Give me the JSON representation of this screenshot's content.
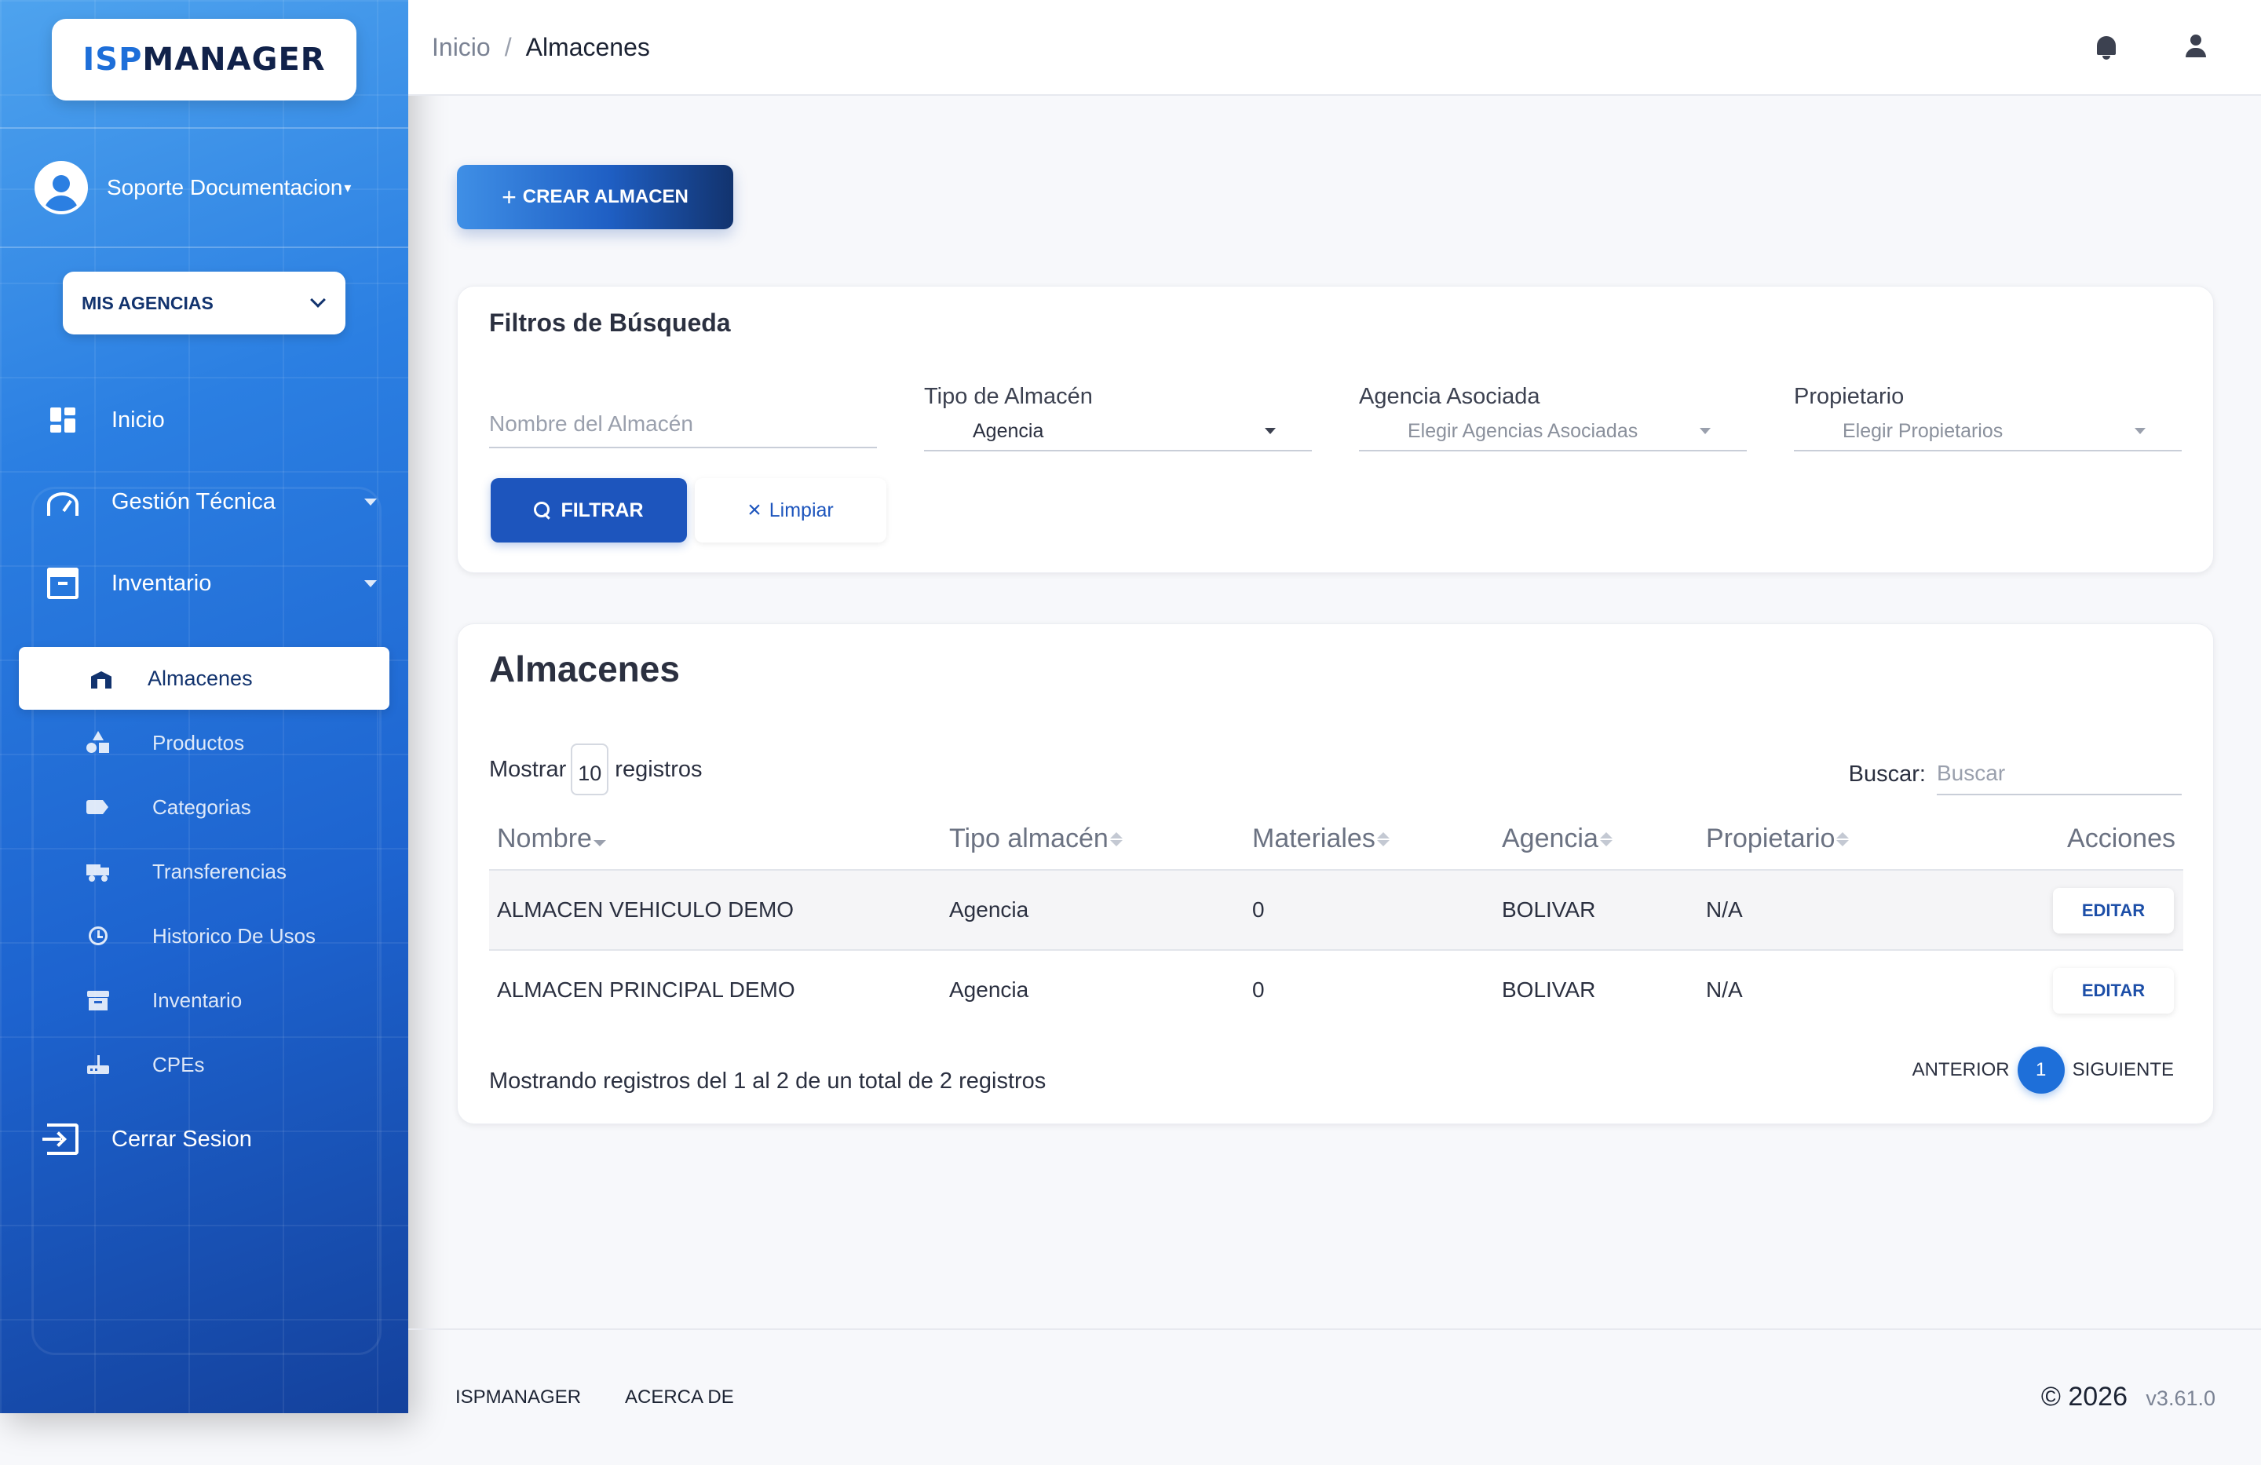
{
  "brand": {
    "logo_part1": "ISP",
    "logo_part2": "MANAGER"
  },
  "user": {
    "name": "Soporte Documentacion"
  },
  "agency_selector": {
    "label": "MIS AGENCIAS"
  },
  "sidebar": {
    "items": [
      {
        "label": "Inicio"
      },
      {
        "label": "Gestión Técnica"
      },
      {
        "label": "Inventario"
      }
    ],
    "sub_items": [
      {
        "label": "Almacenes",
        "active": true
      },
      {
        "label": "Productos"
      },
      {
        "label": "Categorias"
      },
      {
        "label": "Transferencias"
      },
      {
        "label": "Historico De Usos"
      },
      {
        "label": "Inventario"
      },
      {
        "label": "CPEs"
      }
    ],
    "logout": "Cerrar Sesion"
  },
  "breadcrumb": {
    "home": "Inicio",
    "separator": "/",
    "current": "Almacenes"
  },
  "create_button": {
    "icon": "+",
    "label": "CREAR ALMACEN"
  },
  "filters": {
    "title": "Filtros de Búsqueda",
    "name_placeholder": "Nombre del Almacén",
    "type": {
      "label": "Tipo de Almacén",
      "value": "Agencia"
    },
    "agency": {
      "label": "Agencia Asociada",
      "placeholder": "Elegir Agencias Asociadas"
    },
    "owner": {
      "label": "Propietario",
      "placeholder": "Elegir Propietarios"
    },
    "filter_button": "FILTRAR",
    "clear_button": "Limpiar"
  },
  "table": {
    "title": "Almacenes",
    "show_label": "Mostrar",
    "page_length": "10",
    "records_label": "registros",
    "search_label": "Buscar:",
    "search_placeholder": "Buscar",
    "columns": [
      "Nombre",
      "Tipo almacén",
      "Materiales",
      "Agencia",
      "Propietario",
      "Acciones"
    ],
    "rows": [
      {
        "name": "ALMACEN VEHICULO DEMO",
        "type": "Agencia",
        "materials": "0",
        "agency": "BOLIVAR",
        "owner": "N/A",
        "action": "EDITAR"
      },
      {
        "name": "ALMACEN PRINCIPAL DEMO",
        "type": "Agencia",
        "materials": "0",
        "agency": "BOLIVAR",
        "owner": "N/A",
        "action": "EDITAR"
      }
    ],
    "info": "Mostrando registros del 1 al 2 de un total de 2 registros",
    "pagination": {
      "previous": "ANTERIOR",
      "current_page": "1",
      "next": "SIGUIENTE"
    }
  },
  "footer": {
    "links": [
      "ISPMANAGER",
      "ACERCA DE"
    ],
    "copyright": "© 2026",
    "version": "v3.61.0"
  },
  "colors": {
    "primary": "#1d55bd",
    "accent": "#1e6fd9",
    "dark_navy": "#12336e"
  }
}
